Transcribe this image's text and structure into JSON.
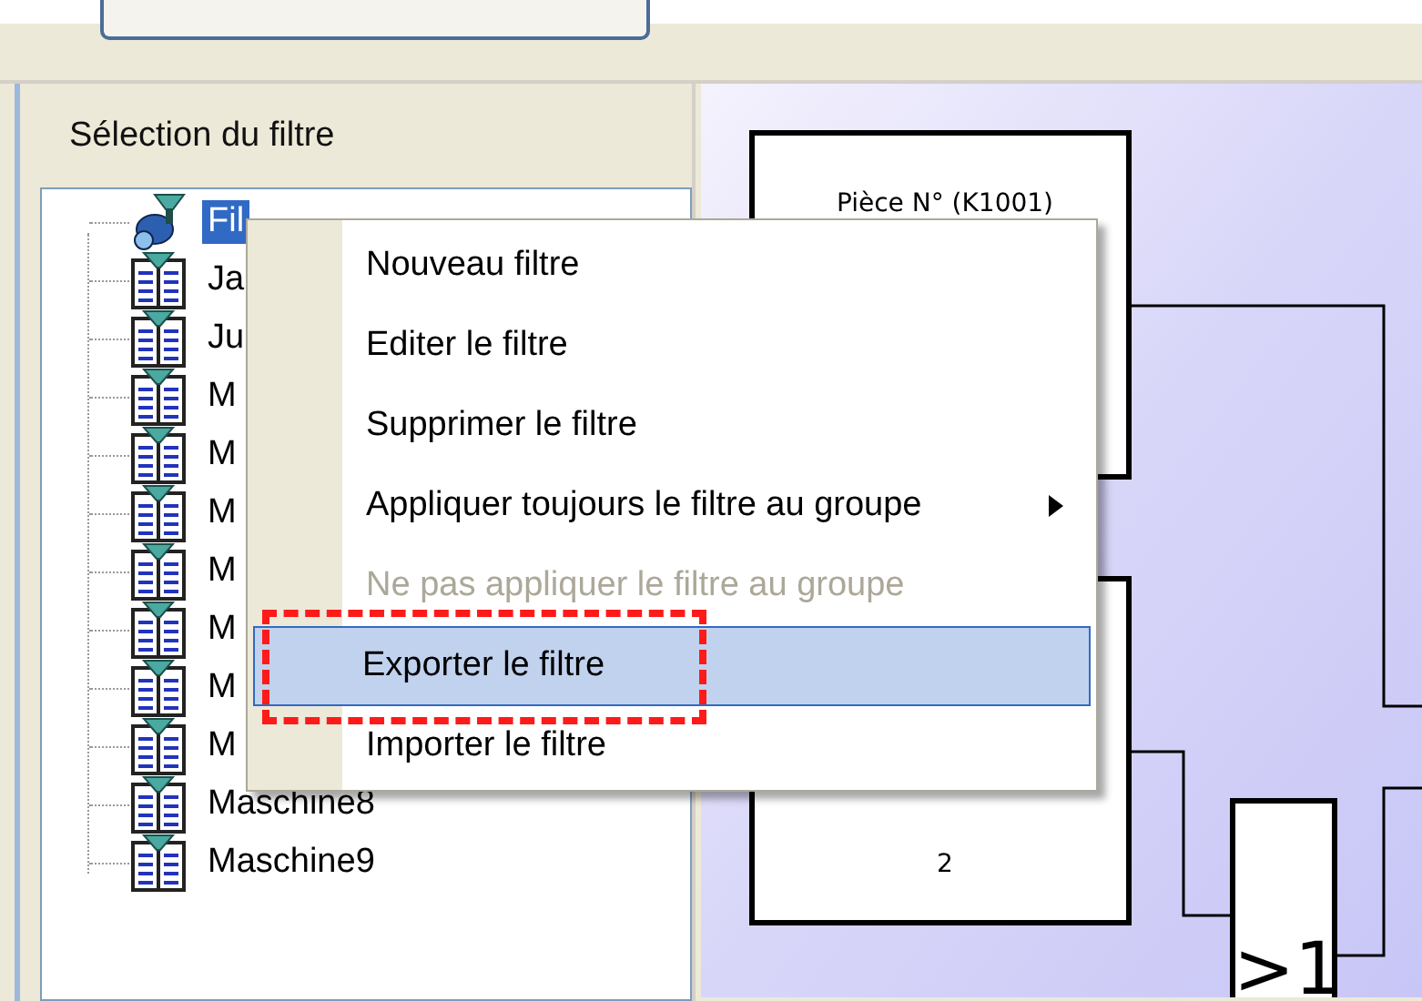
{
  "panel_title": "Sélection du filtre",
  "tree": [
    {
      "kind": "filter",
      "label": "Fil",
      "selected": true
    },
    {
      "kind": "machine",
      "label": "Ja",
      "selected": false
    },
    {
      "kind": "machine",
      "label": "Ju",
      "selected": false
    },
    {
      "kind": "machine",
      "label": "M",
      "selected": false
    },
    {
      "kind": "machine",
      "label": "M",
      "selected": false
    },
    {
      "kind": "machine",
      "label": "M",
      "selected": false
    },
    {
      "kind": "machine",
      "label": "M",
      "selected": false
    },
    {
      "kind": "machine",
      "label": "M",
      "selected": false
    },
    {
      "kind": "machine",
      "label": "M",
      "selected": false
    },
    {
      "kind": "machine",
      "label": "M",
      "selected": false
    },
    {
      "kind": "machine",
      "label": "Maschine8",
      "selected": false
    },
    {
      "kind": "machine",
      "label": "Maschine9",
      "selected": false
    }
  ],
  "diagram": {
    "blocks": [
      {
        "kind": "box",
        "label": "Pièce N° (K1001)"
      },
      {
        "kind": "box",
        "label": "2"
      },
      {
        "kind": "gate",
        "label": ">1"
      }
    ]
  },
  "context_menu": [
    {
      "label": "Nouveau filtre",
      "disabled": false,
      "selected": false,
      "submenu": false
    },
    {
      "label": "Editer le filtre",
      "disabled": false,
      "selected": false,
      "submenu": false
    },
    {
      "label": "Supprimer le filtre",
      "disabled": false,
      "selected": false,
      "submenu": false
    },
    {
      "label": "Appliquer toujours le filtre au groupe",
      "disabled": false,
      "selected": false,
      "submenu": true
    },
    {
      "label": "Ne pas appliquer le filtre au groupe",
      "disabled": true,
      "selected": false,
      "submenu": false
    },
    {
      "label": "Exporter le filtre",
      "disabled": false,
      "selected": true,
      "submenu": false
    },
    {
      "label": "Importer le filtre",
      "disabled": false,
      "selected": false,
      "submenu": false
    }
  ]
}
